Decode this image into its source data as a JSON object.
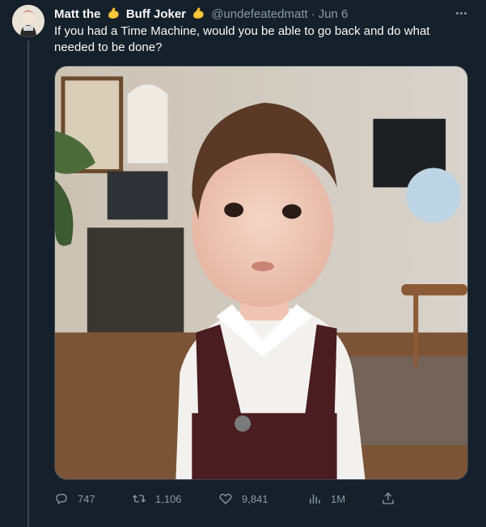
{
  "tweet": {
    "author": {
      "name_part1": "Matt the",
      "name_part2": "Buff Joker",
      "emoji": "flexed-biceps",
      "handle": "@undefeatedmatt",
      "separator": "·",
      "date": "Jun 6"
    },
    "text": "If you had a Time Machine, would you be able to go back and do what needed to be done?",
    "media": {
      "icon": "photo",
      "description_visible": false
    },
    "actions": [
      {
        "name": "reply",
        "icon": "reply-icon",
        "count": "747"
      },
      {
        "name": "retweet",
        "icon": "retweet-icon",
        "count": "1,106"
      },
      {
        "name": "like",
        "icon": "heart-icon",
        "count": "9,841"
      },
      {
        "name": "views",
        "icon": "analytics-icon",
        "count": "1M"
      },
      {
        "name": "share",
        "icon": "share-icon",
        "count": ""
      }
    ]
  },
  "colors": {
    "background": "#15202b",
    "text": "#f7f9f9",
    "secondary": "#8b98a5",
    "border": "#38444d"
  }
}
